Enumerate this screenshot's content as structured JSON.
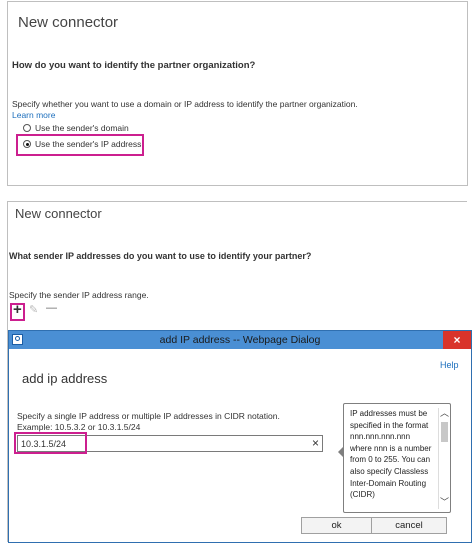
{
  "panel1": {
    "title": "New connector",
    "question": "How do you want to identify the partner organization?",
    "description": "Specify whether you want to use a domain or IP address to identify the partner organization.",
    "learn_more": "Learn more",
    "options": [
      {
        "label": "Use the sender's domain",
        "selected": false
      },
      {
        "label": "Use the sender's IP address",
        "selected": true
      }
    ]
  },
  "panel2": {
    "title": "New connector",
    "question": "What sender IP addresses do you want to use to identify your partner?",
    "description": "Specify the sender IP address range.",
    "toolbar": {
      "add": "+",
      "edit": "✎",
      "remove": "—"
    }
  },
  "dialog": {
    "title": "add IP address -- Webpage Dialog",
    "close": "×",
    "help": "Help",
    "heading": "add ip address",
    "instruction": "Specify a single IP address or multiple IP addresses in CIDR notation.",
    "example": "Example: 10.5.3.2 or 10.3.1.5/24",
    "input_value": "10.3.1.5/24",
    "clear": "×",
    "tooltip": "IP addresses must be specified in the format nnn.nnn.nnn.nnn where nnn is a number from 0 to 255. You can also specify Classless Inter-Domain Routing (CIDR)",
    "ok": "ok",
    "cancel": "cancel"
  },
  "colors": {
    "highlight": "#cc1f8f",
    "link": "#1d6fbd",
    "titlebar": "#4a8fd4",
    "close": "#d9342b"
  }
}
